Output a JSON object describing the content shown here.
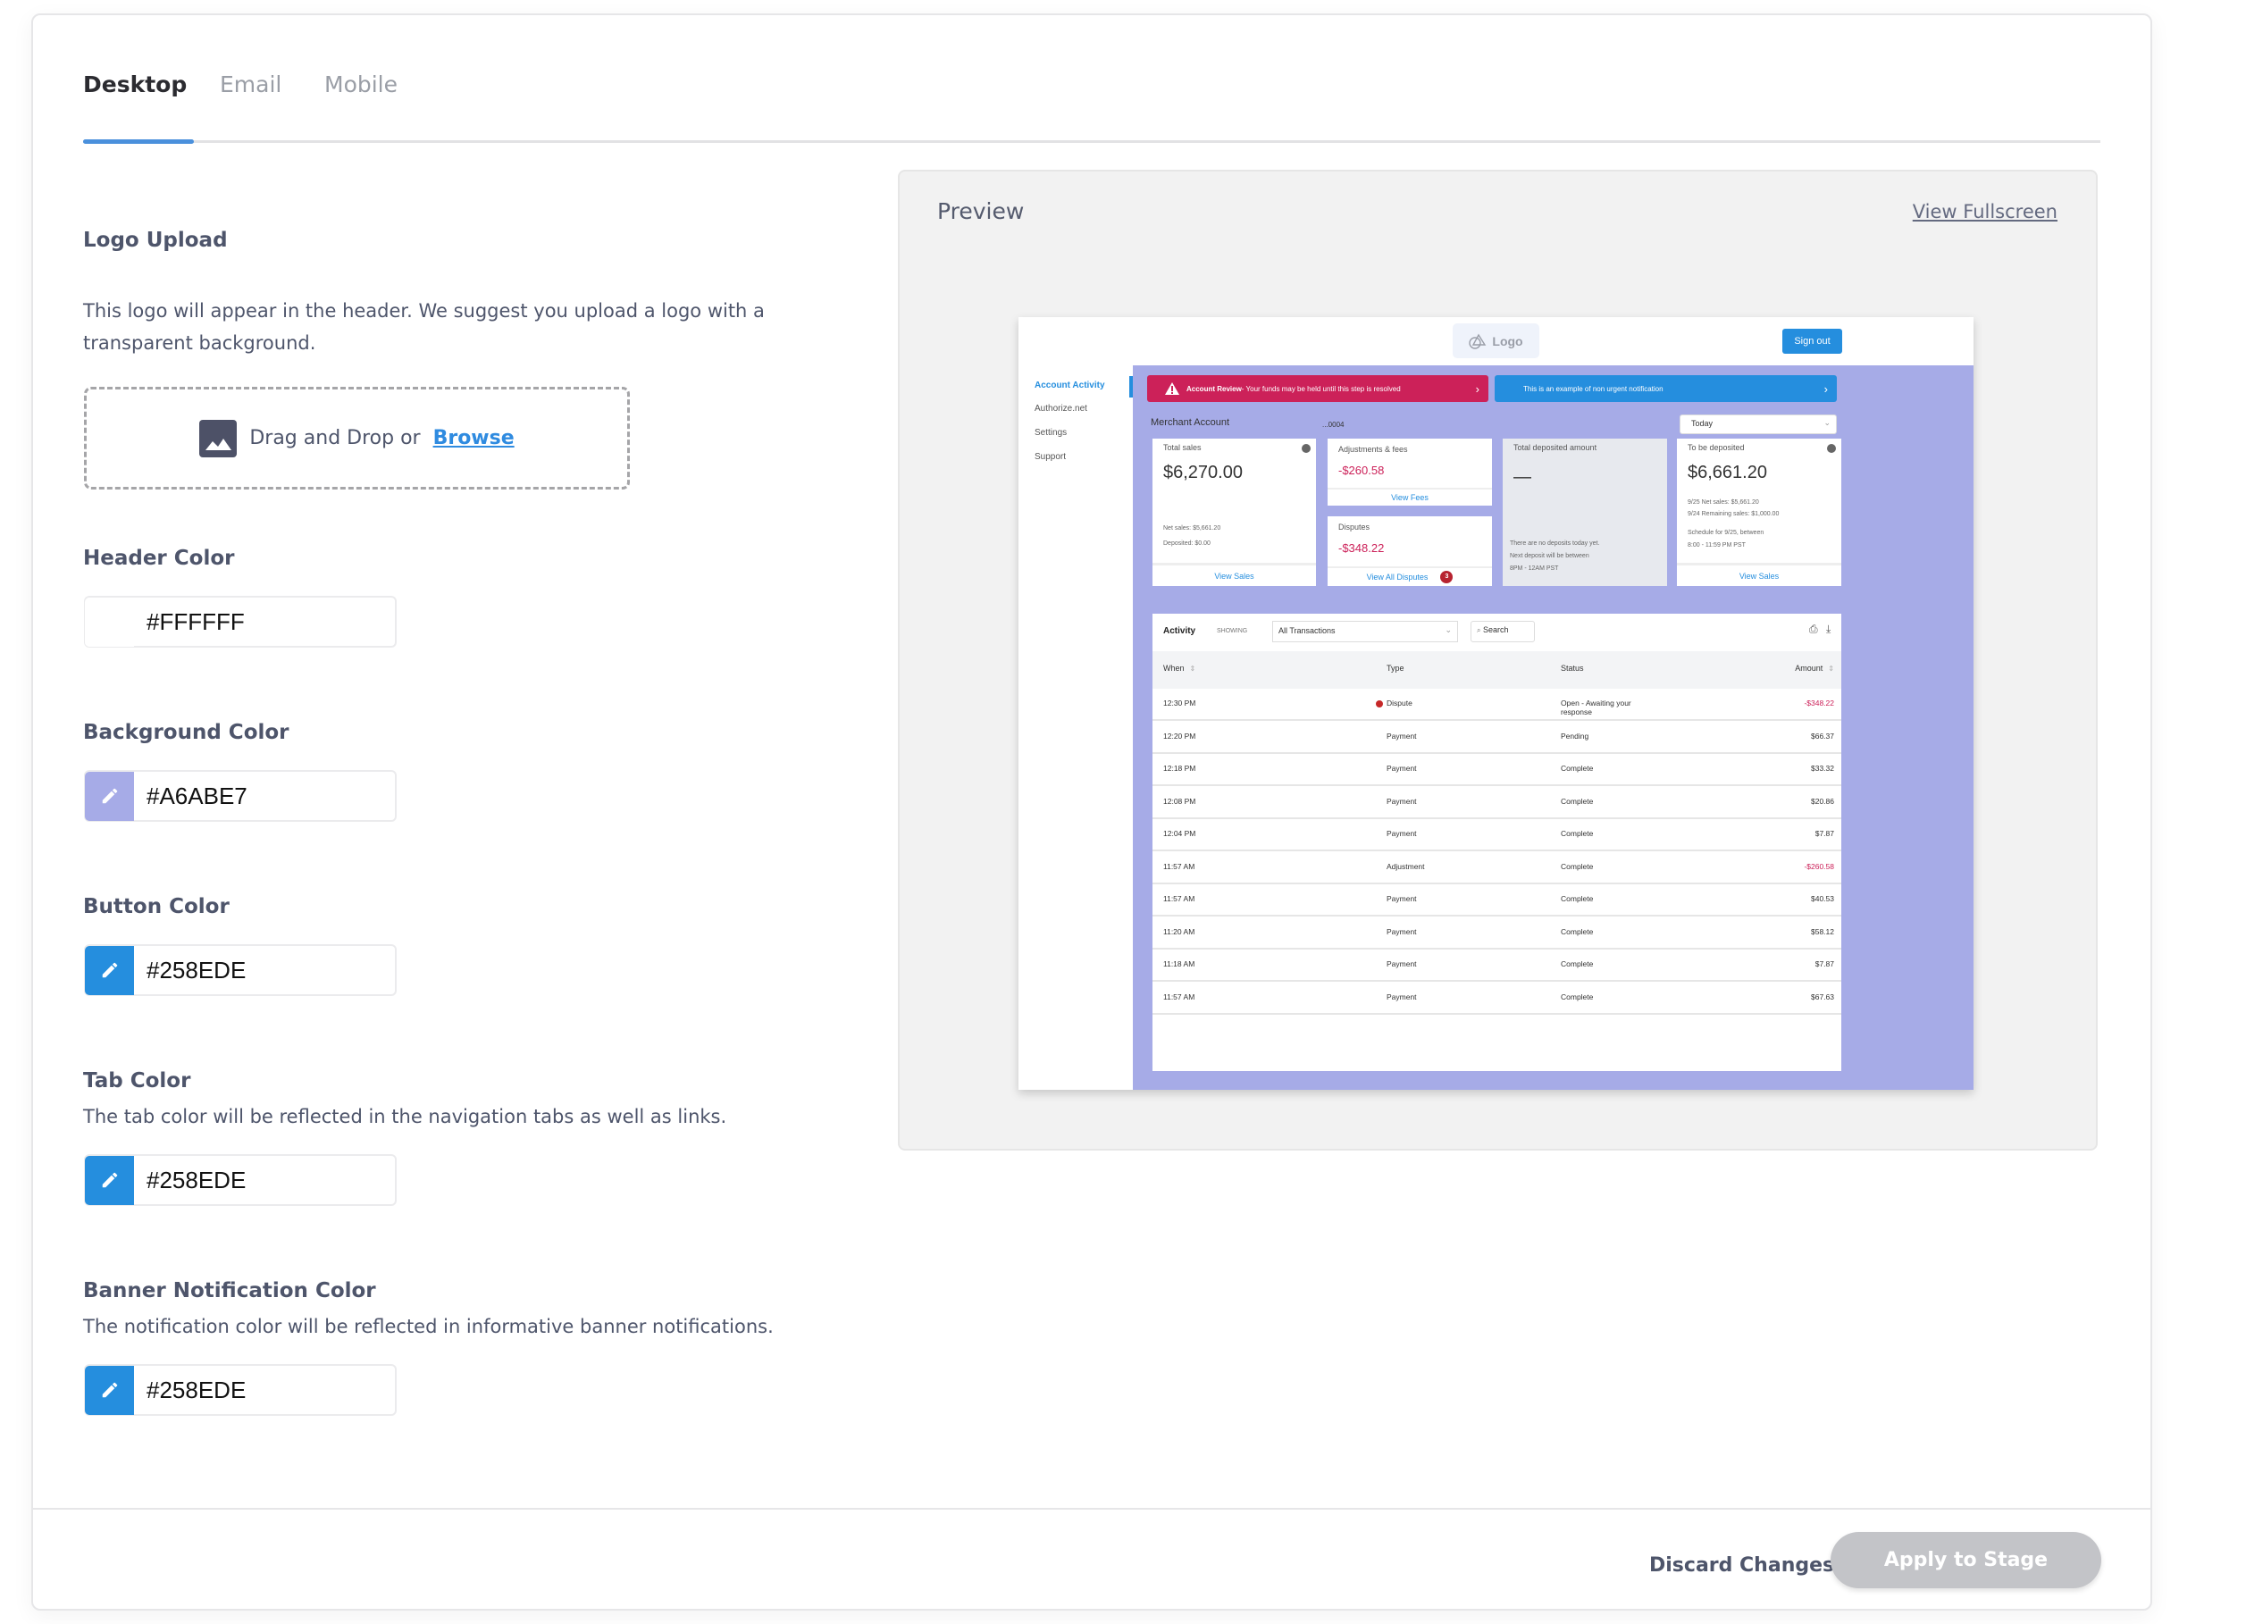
{
  "tabs": [
    {
      "label": "Desktop",
      "active": true
    },
    {
      "label": "Email",
      "active": false
    },
    {
      "label": "Mobile",
      "active": false
    }
  ],
  "logo_upload": {
    "label": "Logo Upload",
    "help": "This logo will appear in the header. We suggest you upload a logo with a transparent background.",
    "drop_text": "Drag and Drop or",
    "browse_label": "Browse",
    "icon": "image-icon"
  },
  "colors": {
    "header": {
      "label": "Header Color",
      "value": "#FFFFFF",
      "swatch": "#FFFFFF"
    },
    "background": {
      "label": "Background Color",
      "value": "#A6ABE7",
      "swatch": "#A6ABE7"
    },
    "button": {
      "label": "Button Color",
      "value": "#258EDE",
      "swatch": "#258EDE"
    },
    "tab": {
      "label": "Tab Color",
      "help": "The tab color will be reflected in the navigation tabs as well as links.",
      "value": "#258EDE",
      "swatch": "#258EDE"
    },
    "banner": {
      "label": "Banner Notification Color",
      "help": "The notification color will be reflected in informative banner notifications.",
      "value": "#258EDE",
      "swatch": "#258EDE"
    }
  },
  "preview": {
    "title": "Preview",
    "fullscreen_link": "View Fullscreen",
    "mock": {
      "logo_text": "Logo",
      "sign_out": "Sign out",
      "nav": [
        "Account Activity",
        "Authorize.net",
        "Settings",
        "Support"
      ],
      "banner_urgent_bold": "Account Review",
      "banner_urgent_text": " - Your funds may be held until this step is resolved",
      "banner_info_text": "This is an example of non urgent notification",
      "merchant_label": "Merchant Account",
      "account_suffix": "...0004",
      "date_filter": "Today",
      "total_sales": {
        "label": "Total sales",
        "value": "$6,270.00",
        "net": "Net sales: $5,661.20",
        "deposited": "Deposited: $0.00",
        "link": "View Sales"
      },
      "adjustments": {
        "label": "Adjustments & fees",
        "value": "-$260.58",
        "link": "View Fees"
      },
      "disputes": {
        "label": "Disputes",
        "value": "-$348.22",
        "link": "View All Disputes",
        "count": "3"
      },
      "total_deposited": {
        "label": "Total deposited amount",
        "value": "—",
        "note1": "There are no deposits today yet.",
        "note2": "Next deposit will be between",
        "note3": "8PM - 12AM PST"
      },
      "to_be_deposited": {
        "label": "To be deposited",
        "value": "$6,661.20",
        "line1": "9/25 Net sales: $5,661.20",
        "line2": "9/24 Remaining sales:  $1,000.00",
        "line3": "Schedule for 9/25, between",
        "line4": "8:00 - 11:59 PM PST",
        "link": "View Sales"
      },
      "activity": {
        "title": "Activity",
        "showing_label": "SHOWING",
        "filter": "All Transactions",
        "search_placeholder": "Search",
        "columns": [
          "When",
          "Type",
          "Status",
          "Amount"
        ],
        "rows": [
          {
            "when": "12:30 PM",
            "type": "Dispute",
            "status": "Open - Awaiting your response",
            "amount": "-$348.22",
            "negative": true,
            "flag": true
          },
          {
            "when": "12:20 PM",
            "type": "Payment",
            "status": "Pending",
            "amount": "$66.37"
          },
          {
            "when": "12:18 PM",
            "type": "Payment",
            "status": "Complete",
            "amount": "$33.32"
          },
          {
            "when": "12:08 PM",
            "type": "Payment",
            "status": "Complete",
            "amount": "$20.86"
          },
          {
            "when": "12:04 PM",
            "type": "Payment",
            "status": "Complete",
            "amount": "$7.87"
          },
          {
            "when": "11:57 AM",
            "type": "Adjustment",
            "status": "Complete",
            "amount": "-$260.58",
            "negative": true
          },
          {
            "when": "11:57 AM",
            "type": "Payment",
            "status": "Complete",
            "amount": "$40.53"
          },
          {
            "when": "11:20 AM",
            "type": "Payment",
            "status": "Complete",
            "amount": "$58.12"
          },
          {
            "when": "11:18 AM",
            "type": "Payment",
            "status": "Complete",
            "amount": "$7.87"
          },
          {
            "when": "11:57 AM",
            "type": "Payment",
            "status": "Complete",
            "amount": "$67.63"
          }
        ]
      }
    }
  },
  "footer": {
    "discard_label": "Discard Changes",
    "apply_label": "Apply to Stage"
  }
}
